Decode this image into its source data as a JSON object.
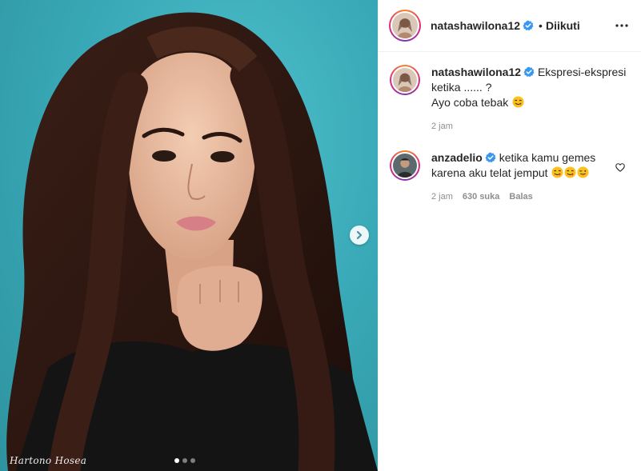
{
  "post": {
    "author": "natashawilona12",
    "follow_state": "Diikuti",
    "bullet": "•",
    "watermark": "Hartono Hosea",
    "carousel": {
      "slides": 3,
      "active": 0
    }
  },
  "caption": {
    "username": "natashawilona12",
    "text": "Ekspresi-ekspresi ketika ...... ?",
    "text_line2": "Ayo coba tebak",
    "emoji": "face-savoring-food",
    "time": "2 jam"
  },
  "comment": {
    "username": "anzadelio",
    "text": "ketika kamu gemes karena aku telat jemput",
    "emojis": [
      "face-savoring-food",
      "face-savoring-food",
      "winking-tongue-face"
    ],
    "time": "2 jam",
    "likes": "630 suka",
    "reply_label": "Balas"
  },
  "colors": {
    "verified": "#3897f0",
    "meta": "#8e8e8e",
    "photo_bg": "#3aaab8",
    "emoji": "#fcc21b"
  },
  "icons": [
    "chevron-right-icon",
    "more-options-icon",
    "verified-badge-icon",
    "heart-outline-icon"
  ]
}
